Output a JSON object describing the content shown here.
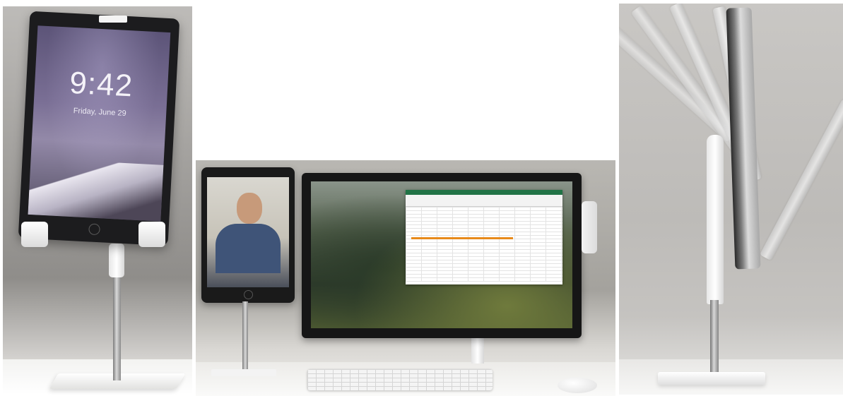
{
  "images": [
    {
      "panel": "left",
      "lockscreen": {
        "time": "9:42",
        "date": "Friday, June 29"
      }
    },
    {
      "panel": "middle"
    },
    {
      "panel": "right"
    }
  ],
  "colors": {
    "background": "#ffffff",
    "spreadsheet_titlebar": "#217346",
    "spreadsheet_highlight": "#e88a1a",
    "device_frame": "#1c1c1e",
    "stand_white": "#f4f4f4"
  }
}
